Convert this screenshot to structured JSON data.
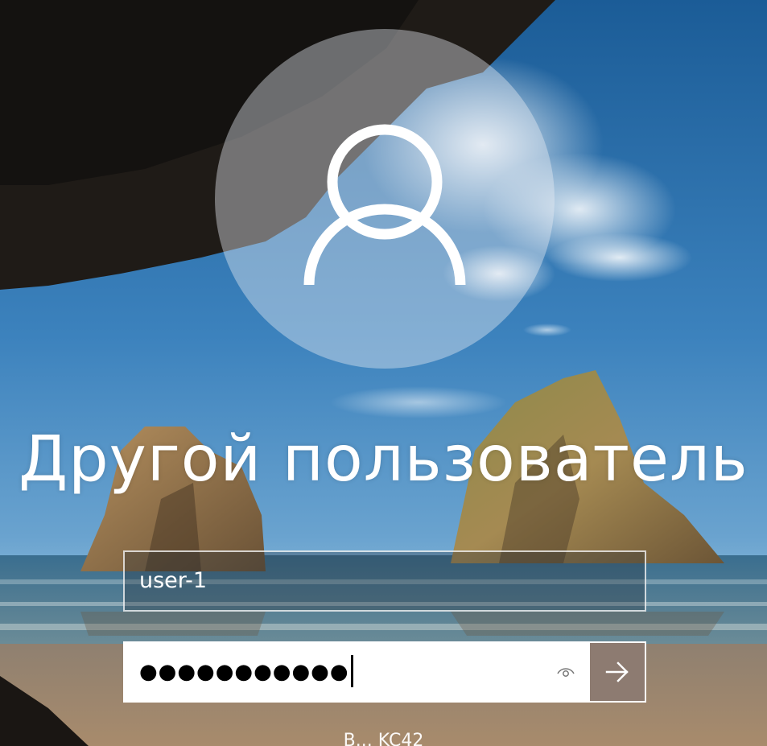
{
  "lock_screen": {
    "user_name": "Другой пользователь",
    "username_value": "user-1",
    "password_mask": "●●●●●●●●●●●",
    "bottom_text": "В... KC42"
  },
  "icons": {
    "avatar": "user-silhouette-icon",
    "reveal": "eye-icon",
    "submit": "arrow-right-icon"
  },
  "colors": {
    "submit_button": "#8d7b71",
    "text": "#ffffff",
    "field_background": "#ffffff"
  }
}
